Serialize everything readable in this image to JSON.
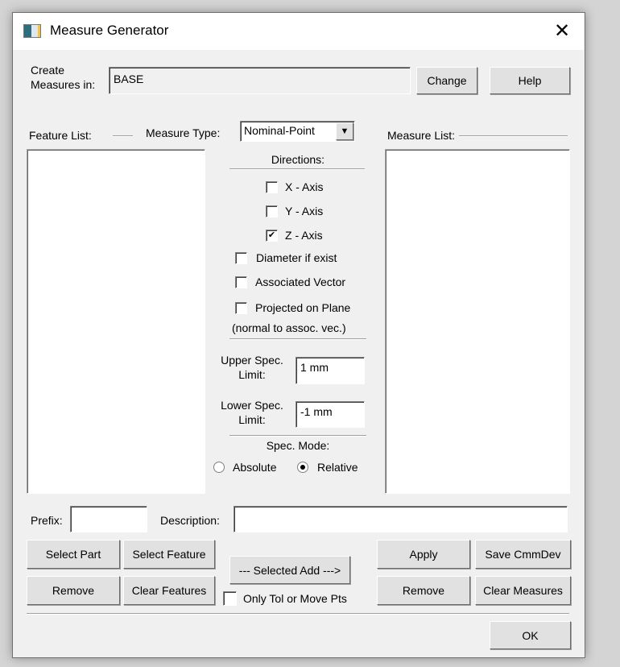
{
  "window": {
    "title": "Measure Generator",
    "close_icon": "close-icon"
  },
  "create_in": {
    "label_line1": "Create",
    "label_line2": "Measures in:",
    "value": "BASE",
    "change": "Change",
    "help": "Help"
  },
  "feature_list": {
    "label": "Feature List:"
  },
  "measure_type": {
    "label": "Measure Type:",
    "selected": "Nominal-Point"
  },
  "measure_list": {
    "label": "Measure List:"
  },
  "directions": {
    "label": "Directions:",
    "x_axis": {
      "label": "X - Axis",
      "checked": false
    },
    "y_axis": {
      "label": "Y - Axis",
      "checked": false
    },
    "z_axis": {
      "label": "Z - Axis",
      "checked": true
    },
    "diameter": {
      "label": "Diameter if exist",
      "checked": false
    },
    "assoc_vector": {
      "label": "Associated Vector",
      "checked": false
    },
    "projected": {
      "label": "Projected on Plane",
      "label2": "(normal to assoc. vec.)",
      "checked": false
    }
  },
  "spec": {
    "upper_label1": "Upper Spec.",
    "upper_label2": "Limit:",
    "upper_value": "1 mm",
    "lower_label1": "Lower Spec.",
    "lower_label2": "Limit:",
    "lower_value": "-1 mm",
    "mode_label": "Spec. Mode:",
    "absolute": "Absolute",
    "relative": "Relative",
    "mode": "Relative"
  },
  "prefix": {
    "label": "Prefix:",
    "value": ""
  },
  "description": {
    "label": "Description:",
    "value": ""
  },
  "buttons": {
    "select_part": "Select Part",
    "select_feature": "Select Feature",
    "remove_feature": "Remove",
    "clear_features": "Clear Features",
    "selected_add": "--- Selected Add --->",
    "only_tol": "Only Tol or Move Pts",
    "apply": "Apply",
    "save_cmmdev": "Save CmmDev",
    "remove_measure": "Remove",
    "clear_measures": "Clear Measures",
    "ok": "OK"
  }
}
